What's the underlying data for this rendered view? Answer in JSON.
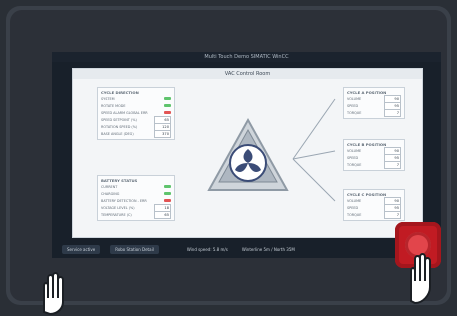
{
  "screen": {
    "title": "Multi Touch Demo SIMATIC WinCC",
    "panel_title": "VAC Control Room"
  },
  "left_top": {
    "heading": "CYCLE DIRECTION",
    "rows": [
      {
        "label": "SYSTEM",
        "type": "led",
        "color": "#5fc46d"
      },
      {
        "label": "ROTATE MODE",
        "type": "led",
        "color": "#5fc46d"
      },
      {
        "label": "SPEED ALARM GLOBAL ERR",
        "type": "led",
        "color": "#e25454"
      },
      {
        "label": "SPEED SETPOINT (%)",
        "type": "value",
        "value": "65"
      },
      {
        "label": "ROTATION SPEED (%)",
        "type": "value",
        "value": "120"
      },
      {
        "label": "BASE ANGLE (DEG)",
        "type": "value",
        "value": "370"
      }
    ]
  },
  "left_bottom": {
    "heading": "BATTERY STATUS",
    "rows": [
      {
        "label": "CURRENT",
        "type": "led",
        "color": "#5fc46d"
      },
      {
        "label": "CHARGING",
        "type": "led",
        "color": "#5fc46d"
      },
      {
        "label": "BATTERY DETECTION - ERR",
        "type": "led",
        "color": "#e25454"
      },
      {
        "label": "VOLTAGE LEVEL (%)",
        "type": "value",
        "value": "18"
      },
      {
        "label": "TEMPERATURE (C)",
        "type": "value",
        "value": "65"
      }
    ]
  },
  "right_groups": [
    {
      "heading": "CYCLE A POSITION",
      "rows": [
        {
          "label": "VOLUME",
          "value": "90"
        },
        {
          "label": "SPEED",
          "value": "95"
        },
        {
          "label": "TORQUE",
          "value": "7"
        }
      ]
    },
    {
      "heading": "CYCLE B POSITION",
      "rows": [
        {
          "label": "VOLUME",
          "value": "90"
        },
        {
          "label": "SPEED",
          "value": "95"
        },
        {
          "label": "TORQUE",
          "value": "7"
        }
      ]
    },
    {
      "heading": "CYCLE C POSITION",
      "rows": [
        {
          "label": "VOLUME",
          "value": "90"
        },
        {
          "label": "SPEED",
          "value": "95"
        },
        {
          "label": "TORQUE",
          "value": "7"
        }
      ]
    }
  ],
  "bottom_bar": {
    "service": "Service active",
    "station": "Robo Station Detail",
    "wind": "Wind speed: 5.8 m/s",
    "winterline": "Winterline 5m / North 35M"
  },
  "colors": {
    "screen_bg": "#18202a",
    "panel_bg": "#f3f5f7",
    "estop": "#c11b23"
  }
}
